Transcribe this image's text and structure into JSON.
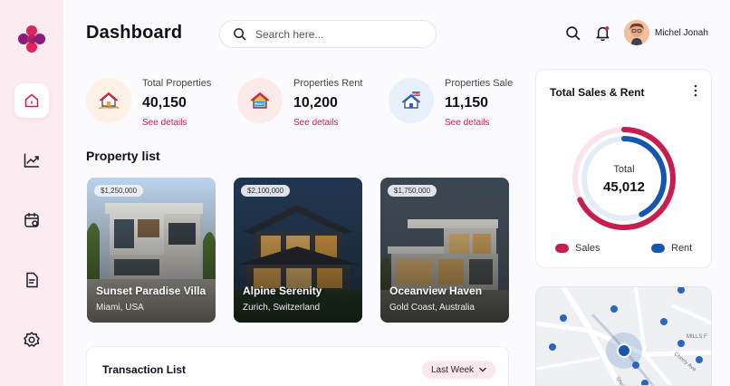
{
  "header": {
    "title": "Dashboard",
    "search_placeholder": "Search here...",
    "user_name": "Michel Jonah"
  },
  "sidebar": {
    "items": [
      {
        "name": "home",
        "active": true
      },
      {
        "name": "analytics",
        "active": false
      },
      {
        "name": "calendar",
        "active": false
      },
      {
        "name": "documents",
        "active": false
      },
      {
        "name": "settings",
        "active": false
      }
    ]
  },
  "stats": [
    {
      "label": "Total Properties",
      "value": "40,150",
      "link": "See details",
      "icon": "house-hand-icon"
    },
    {
      "label": "Properties Rent",
      "value": "10,200",
      "link": "See details",
      "icon": "house-rent-icon"
    },
    {
      "label": "Properties Sale",
      "value": "11,150",
      "link": "See details",
      "icon": "house-sale-icon"
    }
  ],
  "property_list": {
    "title": "Property list",
    "items": [
      {
        "price": "$1,250,000",
        "name": "Sunset Paradise Villa",
        "location": "Miami, USA"
      },
      {
        "price": "$2,100,000",
        "name": "Alpine Serenity",
        "location": "Zurich, Switzerland"
      },
      {
        "price": "$1,750,000",
        "name": "Oceanview Haven",
        "location": "Gold Coast, Australia"
      }
    ]
  },
  "transactions": {
    "title": "Transaction List",
    "filter": "Last Week"
  },
  "sales_chart": {
    "title": "Total Sales & Rent",
    "center_label": "Total",
    "center_value": "45,012",
    "legend": [
      {
        "name": "Sales",
        "color": "#c81e4f"
      },
      {
        "name": "Rent",
        "color": "#1556b0"
      }
    ]
  },
  "map": {
    "labels": [
      "MILLS F",
      "Cherry Ave",
      "Shelb"
    ]
  },
  "colors": {
    "accent": "#c4204f",
    "sidebar_bg": "#fcecf1",
    "rent_blue": "#1556b0"
  }
}
